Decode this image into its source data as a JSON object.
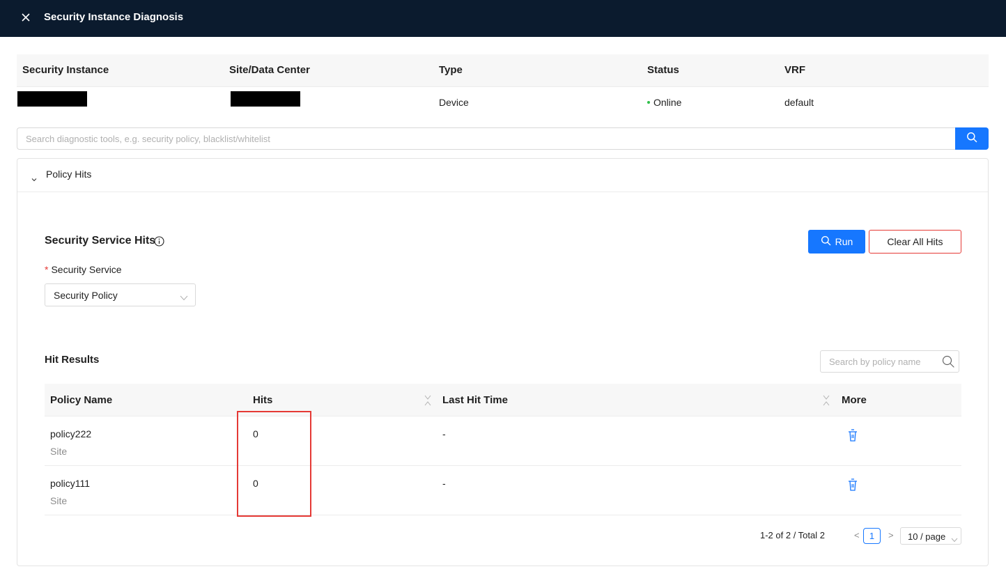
{
  "header": {
    "title": "Security Instance Diagnosis",
    "close_icon": "close-icon"
  },
  "instance_table": {
    "columns": [
      "Security Instance",
      "Site/Data Center",
      "Type",
      "Status",
      "VRF"
    ],
    "row": {
      "security_instance": "",
      "site_data_center": "",
      "type": "Device",
      "status": "Online",
      "status_color": "#2fbf4a",
      "vrf": "default"
    }
  },
  "search": {
    "placeholder": "Search diagnostic tools, e.g. security policy, blacklist/whitelist",
    "value": "",
    "icon": "search-icon"
  },
  "policy_hits_panel": {
    "label": "Policy Hits",
    "expanded": true,
    "section_title": "Security Service Hits",
    "run_label": "Run",
    "clear_label": "Clear All Hits",
    "security_service_label": "Security Service",
    "security_service_value": "Security Policy",
    "hit_results_title": "Hit Results",
    "policy_search_placeholder": "Search by policy name"
  },
  "hit_table": {
    "columns": [
      "Policy Name",
      "Hits",
      "Last Hit Time",
      "More"
    ],
    "rows": [
      {
        "name": "policy222",
        "scope": "Site",
        "hits": "0",
        "last_hit_time": "-"
      },
      {
        "name": "policy111",
        "scope": "Site",
        "hits": "0",
        "last_hit_time": "-"
      }
    ]
  },
  "pagination": {
    "summary": "1-2 of 2 / Total 2",
    "prev": "<",
    "current_page": "1",
    "next": ">",
    "page_size": "10 / page"
  },
  "colors": {
    "topbar": "#0b1b2e",
    "primary": "#1677ff",
    "danger": "#e53935"
  }
}
